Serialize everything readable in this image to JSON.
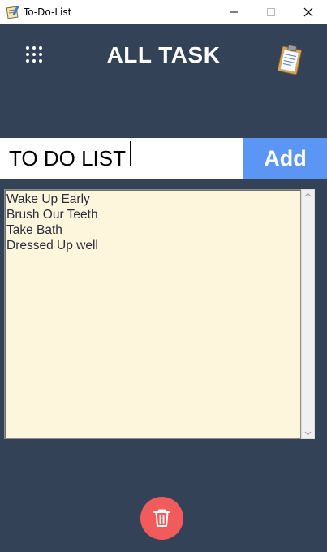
{
  "window": {
    "title": "To-Do-List",
    "icon": "notepad-icon"
  },
  "header": {
    "title": "ALL TASK",
    "menu_icon": "grid-icon",
    "logo_icon": "clipboard-icon"
  },
  "entry": {
    "value": "TO DO LIST",
    "add_label": "Add"
  },
  "tasks": [
    "Wake Up Early",
    "Brush Our Teeth",
    "Take Bath",
    "Dressed Up well"
  ],
  "footer": {
    "delete_icon": "trash-icon"
  },
  "colors": {
    "background": "#344258",
    "accent": "#5b96f4",
    "delete": "#f25b5b",
    "list_bg": "#fdf6dc"
  }
}
